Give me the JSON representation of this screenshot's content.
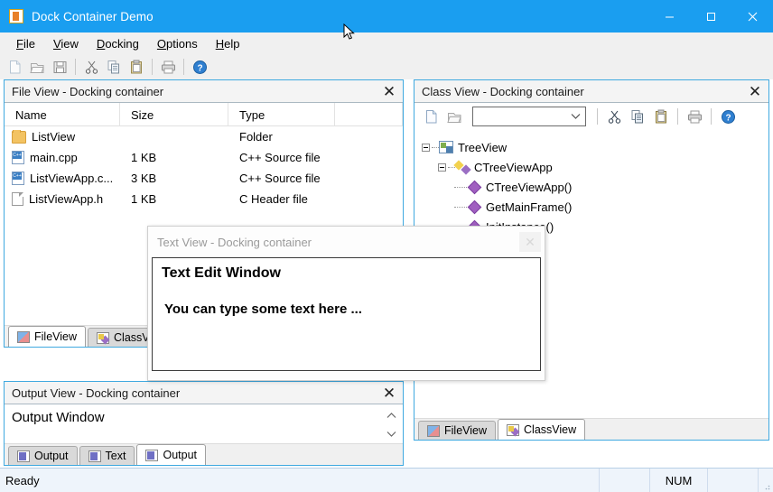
{
  "window": {
    "title": "Dock Container Demo",
    "app_icon": "folder-app-icon",
    "controls": {
      "minimize": "minimize-icon",
      "maximize": "maximize-icon",
      "close": "close-icon"
    },
    "accent_color": "#1a9ef0"
  },
  "menubar": {
    "items": [
      {
        "label": "File",
        "mnemonic": "F"
      },
      {
        "label": "View",
        "mnemonic": "V"
      },
      {
        "label": "Docking",
        "mnemonic": "D"
      },
      {
        "label": "Options",
        "mnemonic": "O"
      },
      {
        "label": "Help",
        "mnemonic": "H"
      }
    ]
  },
  "toolbar": {
    "buttons": [
      {
        "name": "new-icon"
      },
      {
        "name": "open-icon"
      },
      {
        "name": "save-icon"
      },
      {
        "name": "separator"
      },
      {
        "name": "cut-icon"
      },
      {
        "name": "copy-icon"
      },
      {
        "name": "paste-icon"
      },
      {
        "name": "separator"
      },
      {
        "name": "print-icon"
      },
      {
        "name": "separator"
      },
      {
        "name": "help-icon"
      }
    ]
  },
  "file_view": {
    "caption": "File View - Docking container",
    "close": "✕",
    "columns": [
      "Name",
      "Size",
      "Type"
    ],
    "rows": [
      {
        "icon": "folder",
        "name": "ListView",
        "size": "",
        "type": "Folder"
      },
      {
        "icon": "cpp",
        "name": "main.cpp",
        "size": "1 KB",
        "type": "C++ Source file"
      },
      {
        "icon": "cpp",
        "name": "ListViewApp.c...",
        "size": "3 KB",
        "type": "C++ Source file"
      },
      {
        "icon": "doc",
        "name": "ListViewApp.h",
        "size": "1 KB",
        "type": "C Header file"
      }
    ],
    "tabs": [
      {
        "label": "FileView",
        "icon": "fileview",
        "selected": true
      },
      {
        "label": "ClassView",
        "icon": "classview",
        "selected": false
      }
    ]
  },
  "class_view": {
    "caption": "Class View - Docking container",
    "close": "✕",
    "toolbar": [
      {
        "name": "new-icon"
      },
      {
        "name": "open-icon"
      },
      {
        "name": "combo-box"
      },
      {
        "name": "separator"
      },
      {
        "name": "cut-icon"
      },
      {
        "name": "copy-icon"
      },
      {
        "name": "paste-icon"
      },
      {
        "name": "separator"
      },
      {
        "name": "print-icon"
      },
      {
        "name": "separator"
      },
      {
        "name": "help-icon"
      }
    ],
    "combo_value": "",
    "combo_placeholder": "",
    "tree": [
      {
        "label": "TreeView",
        "level": 0,
        "icon": "tree",
        "expander": "minus"
      },
      {
        "label": "CTreeViewApp",
        "level": 1,
        "icon": "cls",
        "expander": "minus"
      },
      {
        "label": "CTreeViewApp()",
        "level": 2,
        "icon": "mth",
        "expander": "none"
      },
      {
        "label": "GetMainFrame()",
        "level": 2,
        "icon": "mth",
        "expander": "none"
      },
      {
        "label": "InitInstance()",
        "level": 2,
        "icon": "mth",
        "expander": "none"
      }
    ],
    "tabs": [
      {
        "label": "FileView",
        "icon": "fileview",
        "selected": false
      },
      {
        "label": "ClassView",
        "icon": "classview",
        "selected": true
      }
    ]
  },
  "text_view": {
    "caption": "Text View - Docking container",
    "close": "✕",
    "line1": "Text Edit Window",
    "line2": "You can type some text here ..."
  },
  "output_view": {
    "caption": "Output View - Docking container",
    "close": "✕",
    "content": "Output Window",
    "scroll_up": "⌃",
    "scroll_down": "⌄",
    "tabs": [
      {
        "label": "Output",
        "icon": "out",
        "selected": false
      },
      {
        "label": "Text",
        "icon": "out",
        "selected": false
      },
      {
        "label": "Output",
        "icon": "out",
        "selected": true
      }
    ]
  },
  "statusbar": {
    "message": "Ready",
    "panes": [
      "",
      "NUM",
      ""
    ]
  }
}
